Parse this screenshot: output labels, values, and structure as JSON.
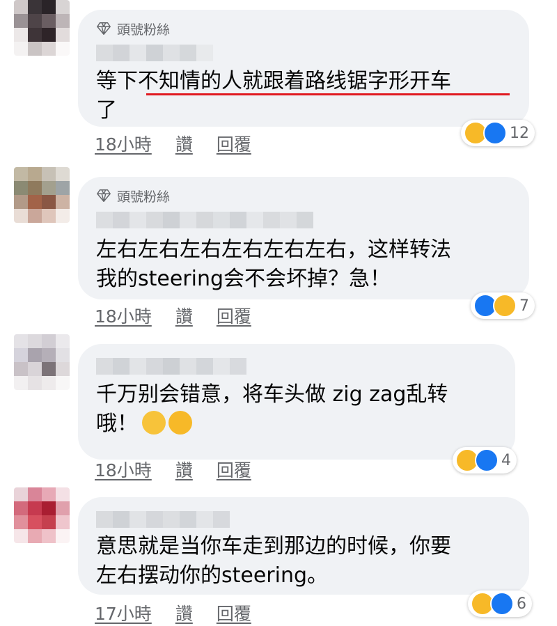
{
  "comments": [
    {
      "badge": "頭號粉絲",
      "text": "等下不知情的人就跟着路线锯字形开车\n了",
      "time": "18小時",
      "like_label": "讚",
      "reply_label": "回覆",
      "reactions": [
        "haha-icon",
        "like-icon"
      ],
      "reaction_count": "12"
    },
    {
      "badge": "頭號粉絲",
      "text": "左右左右左右左右左右左右，这样转法\n我的steering会不会坏掉？急！",
      "time": "18小時",
      "like_label": "讚",
      "reply_label": "回覆",
      "reactions": [
        "like-icon",
        "haha-icon"
      ],
      "reaction_count": "7"
    },
    {
      "badge": "",
      "text": "千万别会错意，将车头做 zig zag乱转\n哦！",
      "time": "18小時",
      "like_label": "讚",
      "reply_label": "回覆",
      "reactions": [
        "haha-icon",
        "like-icon"
      ],
      "reaction_count": "4"
    },
    {
      "badge": "",
      "text": "意思就是当你车走到那边的时候，你要\n左右摆动你的steering。",
      "time": "17小時",
      "like_label": "讚",
      "reply_label": "回覆",
      "reactions": [
        "haha-icon",
        "like-icon"
      ],
      "reaction_count": "6"
    }
  ],
  "colors": {
    "bubble": "#f0f2f5",
    "meta_text": "#65676b",
    "like_blue": "#1877f2",
    "haha_yellow": "#f7b928",
    "highlight_underline": "#e0191f"
  }
}
